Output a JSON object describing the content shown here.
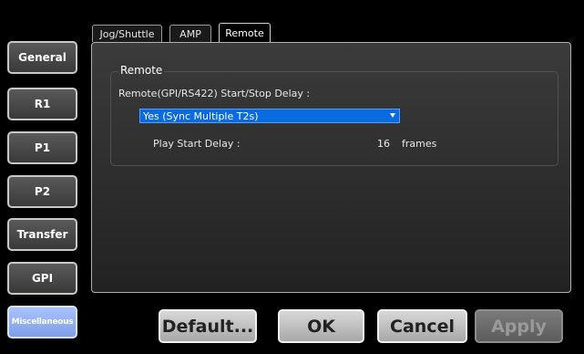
{
  "sidebar": {
    "items": [
      {
        "label": "General"
      },
      {
        "label": "R1"
      },
      {
        "label": "P1"
      },
      {
        "label": "P2"
      },
      {
        "label": "Transfer"
      },
      {
        "label": "GPI"
      },
      {
        "label": "Miscellaneous",
        "active": true
      }
    ]
  },
  "tabs": [
    {
      "label": "Jog/Shuttle"
    },
    {
      "label": "AMP"
    },
    {
      "label": "Remote",
      "active": true
    }
  ],
  "remote": {
    "group_title": "Remote",
    "start_stop_label": "Remote(GPI/RS422) Start/Stop Delay :",
    "start_stop_value": "Yes (Sync Multiple T2s)",
    "play_start_delay_label": "Play Start Delay :",
    "play_start_delay_value": "16",
    "play_start_delay_unit": "frames"
  },
  "buttons": {
    "default": "Default...",
    "ok": "OK",
    "cancel": "Cancel",
    "apply": "Apply"
  },
  "colors": {
    "select_bg": "#0a6be0",
    "active_side_bg": "#8fabf0",
    "disabled_text": "#9a9a9a"
  }
}
